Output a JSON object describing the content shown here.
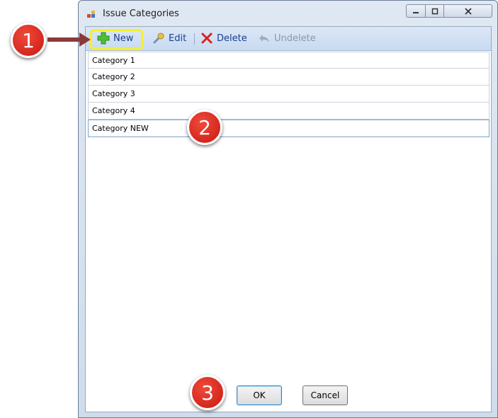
{
  "window": {
    "title": "Issue Categories"
  },
  "toolbar": {
    "new_label": "New",
    "edit_label": "Edit",
    "delete_label": "Delete",
    "undelete_label": "Undelete"
  },
  "list": {
    "items": [
      {
        "label": "Category 1"
      },
      {
        "label": "Category 2"
      },
      {
        "label": "Category 3"
      },
      {
        "label": "Category 4"
      },
      {
        "label": "Category NEW"
      }
    ]
  },
  "footer": {
    "ok_label": "OK",
    "cancel_label": "Cancel"
  },
  "annotations": {
    "step1": "1",
    "step2": "2",
    "step3": "3"
  },
  "colors": {
    "callout": "#d4221a",
    "highlight": "#f5f02a",
    "toolbar_text": "#1b3f8c"
  }
}
